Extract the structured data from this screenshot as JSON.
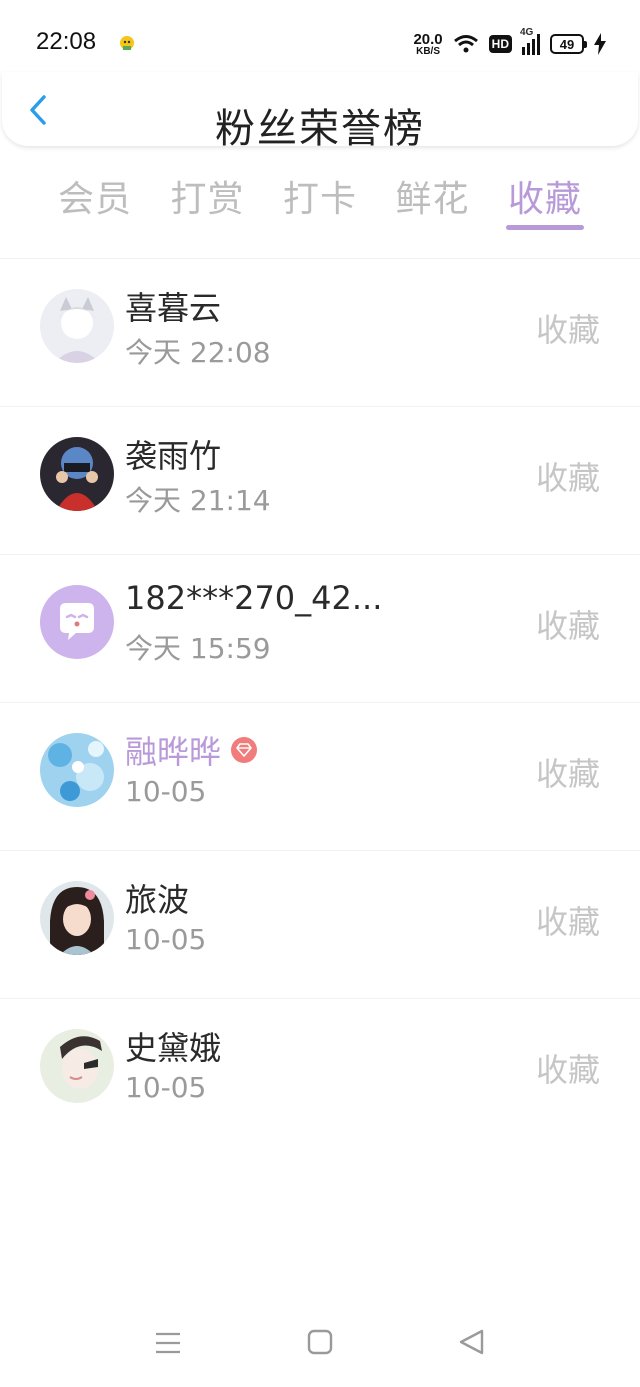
{
  "status_bar": {
    "time": "22:08",
    "net_speed_value": "20.0",
    "net_speed_unit": "KB/S",
    "hd_label": "HD",
    "network_type": "4G",
    "battery": "49"
  },
  "header": {
    "title": "粉丝荣誉榜",
    "back_icon": "chevron-left-icon",
    "back_color": "#2b9de9"
  },
  "tabs": [
    {
      "label": "会员"
    },
    {
      "label": "打赏"
    },
    {
      "label": "打卡"
    },
    {
      "label": "鲜花"
    },
    {
      "label": "收藏",
      "active": true
    }
  ],
  "accent_color": "#b99ad9",
  "fans": [
    {
      "name": "喜暮云",
      "time": "今天 22:08",
      "action": "收藏",
      "avatar": "avatar-photo"
    },
    {
      "name": "袭雨竹",
      "time": "今天 21:14",
      "action": "收藏",
      "avatar": "avatar-photo"
    },
    {
      "name": "182***270_42...",
      "time": "今天 15:59",
      "action": "收藏",
      "avatar": "default-chat-avatar-icon"
    },
    {
      "name": "融晔晔",
      "time": "10-05",
      "action": "收藏",
      "avatar": "avatar-photo",
      "vip_badge": "diamond-icon"
    },
    {
      "name": "旅波",
      "time": "10-05",
      "action": "收藏",
      "avatar": "avatar-photo"
    },
    {
      "name": "史黛娥",
      "time": "10-05",
      "action": "收藏",
      "avatar": "avatar-photo"
    }
  ],
  "system_nav": {
    "icons": [
      "menu-icon",
      "home-square-icon",
      "back-triangle-icon"
    ]
  }
}
